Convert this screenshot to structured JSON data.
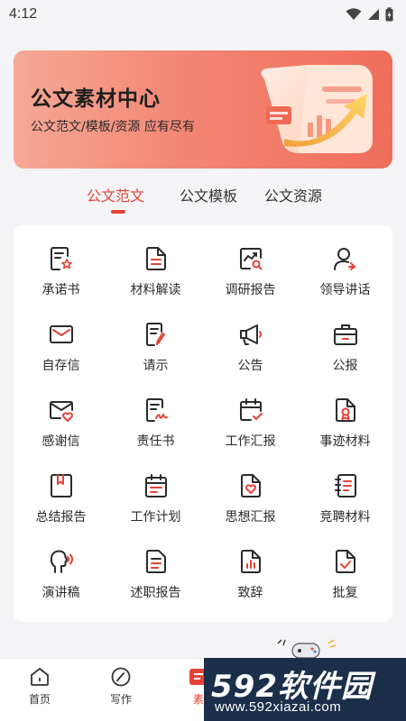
{
  "status_bar": {
    "time": "4:12"
  },
  "banner": {
    "title": "公文素材中心",
    "subtitle": "公文范文/模板/资源 应有尽有"
  },
  "tabs": [
    {
      "label": "公文范文",
      "active": true
    },
    {
      "label": "公文模板",
      "active": false
    },
    {
      "label": "公文资源",
      "active": false
    }
  ],
  "categories": [
    {
      "label": "承诺书",
      "icon": "document-star-icon"
    },
    {
      "label": "材料解读",
      "icon": "document-lines-icon"
    },
    {
      "label": "调研报告",
      "icon": "chart-magnifier-icon"
    },
    {
      "label": "领导讲话",
      "icon": "person-speaking-icon"
    },
    {
      "label": "自存信",
      "icon": "envelope-icon"
    },
    {
      "label": "请示",
      "icon": "document-pen-icon"
    },
    {
      "label": "公告",
      "icon": "megaphone-icon"
    },
    {
      "label": "公报",
      "icon": "briefcase-icon"
    },
    {
      "label": "感谢信",
      "icon": "envelope-heart-icon"
    },
    {
      "label": "责任书",
      "icon": "document-signature-icon"
    },
    {
      "label": "工作汇报",
      "icon": "calendar-check-icon"
    },
    {
      "label": "事迹材料",
      "icon": "document-medal-icon"
    },
    {
      "label": "总结报告",
      "icon": "bookmark-book-icon"
    },
    {
      "label": "工作计划",
      "icon": "calendar-lines-icon"
    },
    {
      "label": "思想汇报",
      "icon": "document-heart-icon"
    },
    {
      "label": "竞聘材料",
      "icon": "notebook-icon"
    },
    {
      "label": "演讲稿",
      "icon": "head-sound-icon"
    },
    {
      "label": "述职报告",
      "icon": "clipboard-lines-icon"
    },
    {
      "label": "致辞",
      "icon": "document-bar-chart-icon"
    },
    {
      "label": "批复",
      "icon": "document-check-icon"
    }
  ],
  "bottom_nav": [
    {
      "label": "首页",
      "icon": "home-icon"
    },
    {
      "label": "写作",
      "icon": "pen-circle-icon"
    },
    {
      "label": "素",
      "icon": "material-icon"
    }
  ],
  "watermark": {
    "brand": "592软件园",
    "url": "www.592xiazai.com"
  },
  "colors": {
    "accent": "#e64236",
    "banner_start": "#f6a896",
    "banner_end": "#ef6e5a",
    "icon_stroke": "#2b2b2b"
  }
}
